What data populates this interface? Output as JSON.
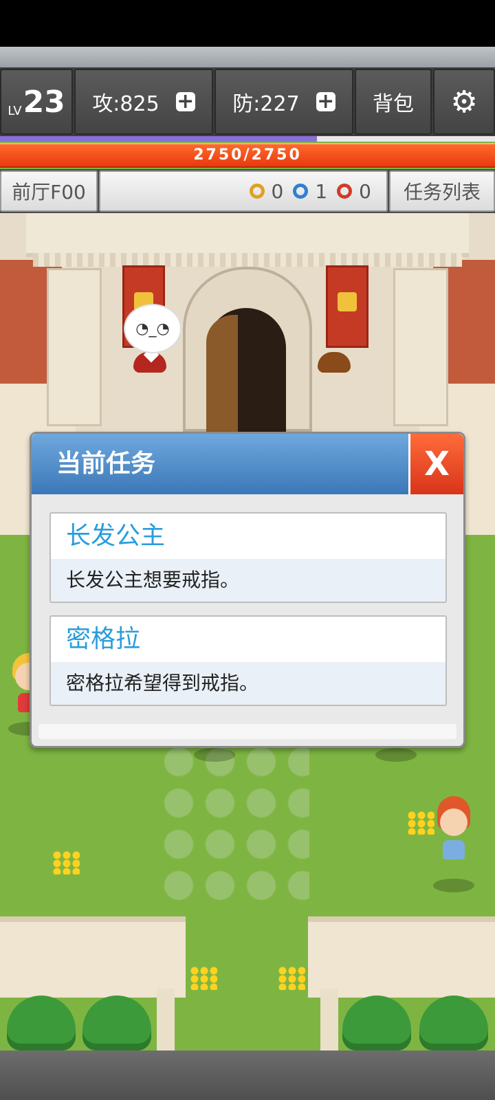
{
  "hud": {
    "level_prefix": "LV",
    "level": "23",
    "attack": "攻:825",
    "defense": "防:227",
    "bag": "背包",
    "settings_icon": "gear-icon",
    "plus_symbol": "+",
    "xp_progress": 0.64,
    "hp_text": "2750/2750"
  },
  "info": {
    "floor": "前厅F00",
    "keys": [
      {
        "color": "#e0a020",
        "count": "0",
        "icon": "yellow-key-icon"
      },
      {
        "color": "#2f7fd0",
        "count": "1",
        "icon": "blue-key-icon"
      },
      {
        "color": "#d23a2a",
        "count": "0",
        "icon": "red-key-icon"
      }
    ],
    "task_list": "任务列表"
  },
  "scene": {
    "speech_face": "◔_◔"
  },
  "dialog": {
    "title": "当前任务",
    "close_label": "X",
    "tasks": [
      {
        "name": "长发公主",
        "desc": "长发公主想要戒指。"
      },
      {
        "name": "密格拉",
        "desc": "密格拉希望得到戒指。"
      }
    ]
  },
  "colors": {
    "accent_blue": "#3b78b7",
    "close_red": "#d8341a",
    "task_name": "#2a9ddb",
    "hp": "#e93a10",
    "xp": "#8a6fd6"
  }
}
